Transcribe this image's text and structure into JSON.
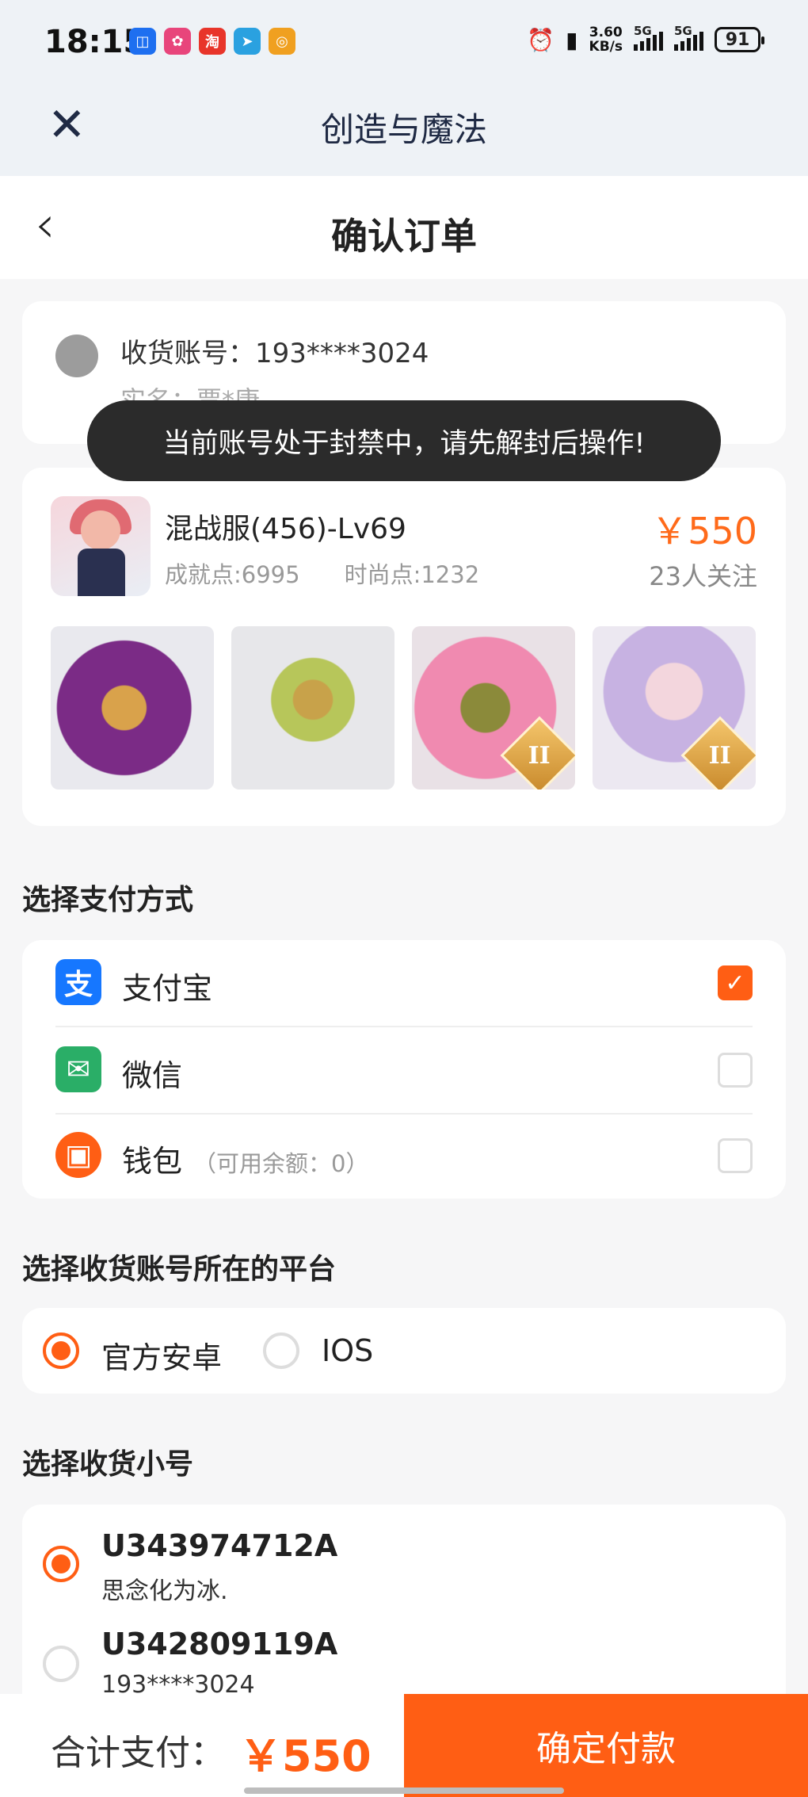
{
  "status_bar": {
    "time": "18:15",
    "net_speed_value": "3.60",
    "net_speed_unit": "KB/s",
    "signal_1": "5G",
    "signal_2": "5G",
    "battery": "91",
    "app_icons": [
      "qq-browser-icon",
      "38-festival-icon",
      "taobao-icon",
      "telegram-icon",
      "target-icon"
    ]
  },
  "mini_header": {
    "title": "创造与魔法"
  },
  "nav": {
    "title": "确认订单"
  },
  "account": {
    "label": "收货账号：193****3024",
    "realname": "实名：贾*康"
  },
  "toast": "当前账号处于封禁中，请先解封后操作!",
  "product": {
    "name": "混战服(456)-Lv69",
    "achievement": "成就点:6995",
    "fashion": "时尚点:1232",
    "price": "￥550",
    "followers": "23人关注",
    "thumb_badges": [
      "",
      "",
      "II",
      "II"
    ]
  },
  "payment": {
    "section_title": "选择支付方式",
    "options": [
      {
        "label": "支付宝",
        "hint": "",
        "icon": "alipay-icon",
        "checked": true
      },
      {
        "label": "微信",
        "hint": "",
        "icon": "wechat-icon",
        "checked": false
      },
      {
        "label": "钱包",
        "hint": "（可用余额：0）",
        "icon": "wallet-icon",
        "checked": false
      }
    ]
  },
  "platform": {
    "section_title": "选择收货账号所在的平台",
    "options": [
      {
        "label": "官方安卓",
        "selected": true
      },
      {
        "label": "IOS",
        "selected": false
      }
    ]
  },
  "sub_accounts": {
    "section_title": "选择收货小号",
    "items": [
      {
        "id": "U343974712A",
        "nickname": "思念化为冰.",
        "selected": true
      },
      {
        "id": "U342809119A",
        "nickname": "193****3024",
        "selected": false
      }
    ]
  },
  "footer": {
    "total_label": "合计支付：",
    "total_value": "￥550",
    "pay_button": "确定付款"
  },
  "colors": {
    "accent": "#ff5e14",
    "price": "#ff6a1a",
    "alipay": "#1677ff",
    "wechat": "#2aae67"
  }
}
